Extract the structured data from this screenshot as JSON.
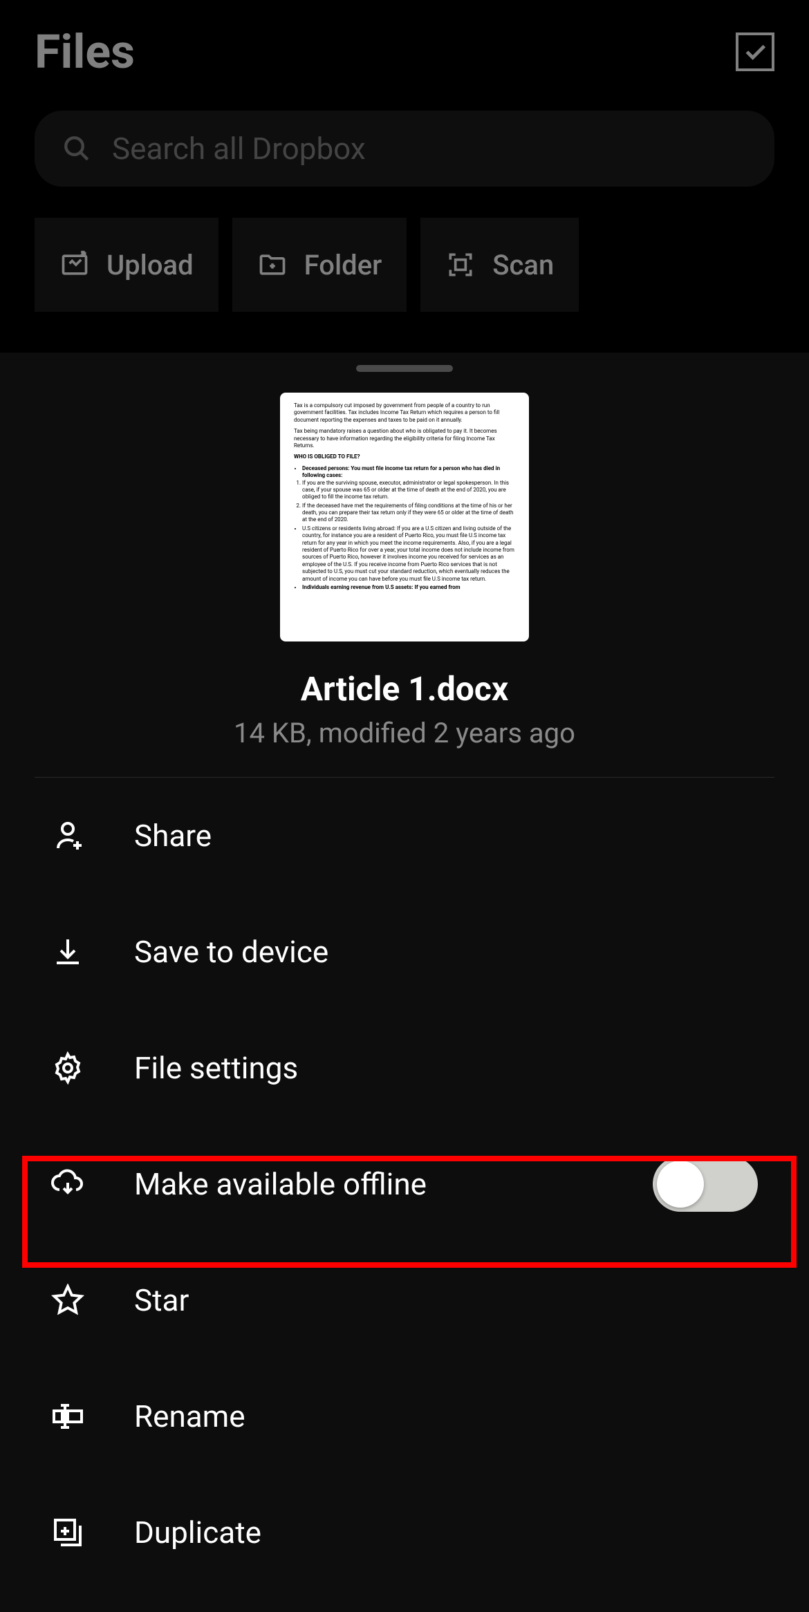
{
  "header": {
    "title": "Files"
  },
  "search": {
    "placeholder": "Search all Dropbox"
  },
  "actions": {
    "upload": "Upload",
    "folder": "Folder",
    "scan": "Scan"
  },
  "file": {
    "name": "Article 1.docx",
    "meta": "14 KB, modified 2 years ago"
  },
  "menu": {
    "share": "Share",
    "save": "Save to device",
    "settings": "File settings",
    "offline": "Make available offline",
    "star": "Star",
    "rename": "Rename",
    "duplicate": "Duplicate"
  },
  "thumbnail": {
    "p1": "Tax is a compulsory cut imposed by government from people of a country to run government facilities. Tax includes Income Tax Return which requires a person to fill document reporting the expenses and taxes to be paid on it annually.",
    "p2": "Tax being mandatory raises a question about who is obligated to pay it. It becomes necessary to have information regarding the eligibility criteria for filing Income Tax Returns.",
    "h1": "WHO IS OBLIGED TO FILE?",
    "b1": "Deceased persons: You must file income tax return for a person who has died in following cases:",
    "l1": "If you are the surviving spouse, executor, administrator or legal spokesperson. In this case, if your spouse was 65 or older at the time of death at the end of 2020, you are obliged to fill the income tax return.",
    "l2": "If the deceased have met the requirements of filing conditions at the time of his or her death, you can prepare their tax return only if they were 65 or older at the time of death at the end of 2020.",
    "b2": "U.S citizens or residents living abroad: If you are a U.S citizen and living outside of the country, for instance you are a resident of Puerto Rico, you must file U.S income tax return for any year in which you meet the income requirements. Also, if you are a legal resident of Puerto Rico for over a year, your total income does not include income from sources of Puerto Rico, however it involves income you received for services as an employee of the U.S. If you receive income from Puerto Rico services that is not subjected to U.S, you must cut your standard reduction, which eventually reduces the amount of income you can have before you must file U.S income tax return.",
    "b3": "Individuals earning revenue from U.S assets: If you earned from"
  }
}
